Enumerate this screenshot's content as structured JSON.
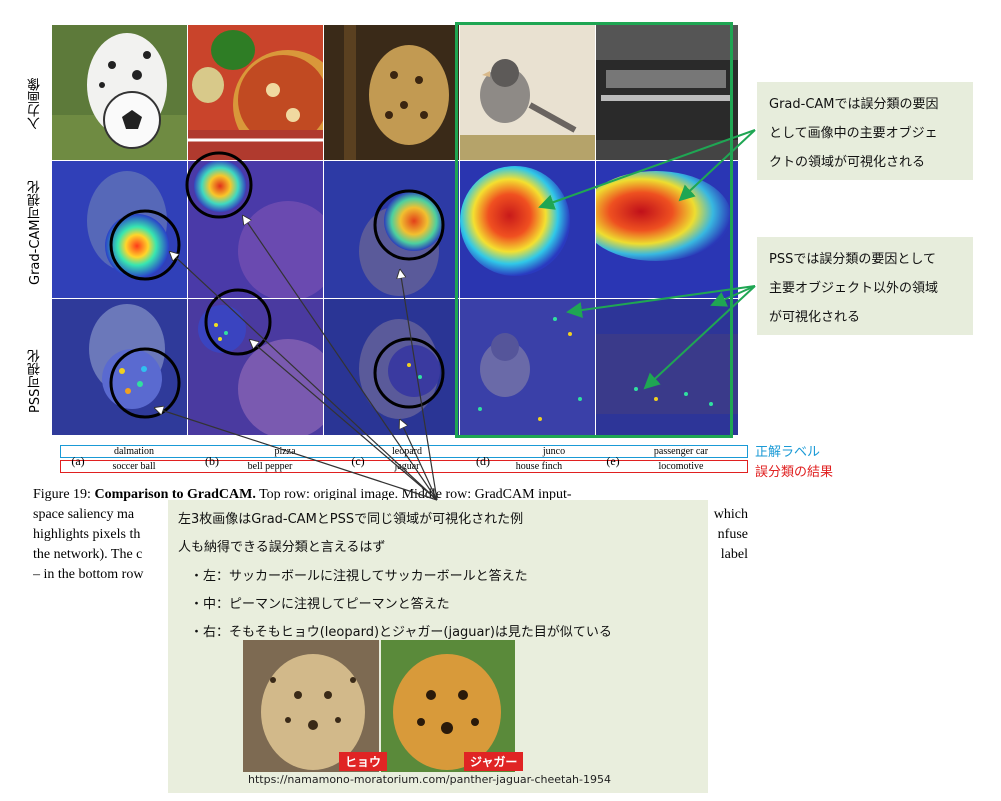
{
  "row_labels": [
    "入力画像",
    "Grad-CAM可視化",
    "PSS可視化"
  ],
  "columns": [
    {
      "letter": "(a)",
      "true_label": "dalmation",
      "misclassified": "soccer ball"
    },
    {
      "letter": "(b)",
      "true_label": "pizza",
      "misclassified": "bell pepper"
    },
    {
      "letter": "(c)",
      "true_label": "leopard",
      "misclassified": "jaguar"
    },
    {
      "letter": "(d)",
      "true_label": "junco",
      "misclassified": "house finch"
    },
    {
      "letter": "(e)",
      "true_label": "passenger car",
      "misclassified": "locomotive"
    }
  ],
  "legend": {
    "true_label": "正解ラベル",
    "misclassified": "誤分類の結果",
    "true_color": "#1a9ad6",
    "mis_color": "#e02020"
  },
  "caption": {
    "figure_label": "Figure 19: ",
    "title": "Comparison to GradCAM.",
    "line1_rest": " Top row: original image. Middle row: GradCAM input-",
    "line2_left": "space saliency ma",
    "line2_right": "which",
    "line3_left": "highlights pixels th",
    "line3_right": "nfuse",
    "line4_left": "the network). The c",
    "line4_right": "label",
    "line5_left": "– in the bottom row"
  },
  "notes": {
    "gradcam": [
      "Grad-CAMでは誤分類の要因",
      "として画像中の主要オブジェ",
      "クトの領域が可視化される"
    ],
    "pss": [
      "PSSでは誤分類の要因として",
      "主要オブジェクト以外の領域",
      "が可視化される"
    ]
  },
  "bigbox": {
    "line1": "左3枚画像はGrad-CAMとPSSで同じ領域が可視化された例",
    "line2": "人も納得できる誤分類と言えるはず",
    "line3": "・左：サッカーボールに注視してサッカーボールと答えた",
    "line4": "・中：ピーマンに注視してピーマンと答えた",
    "line5": "・右：そもそもヒョウ(leopard)とジャガー(jaguar)は見た目が似ている",
    "tag_left": "ヒョウ",
    "tag_right": "ジャガー",
    "url": "https://namamono-moratorium.com/panther-jaguar-cheetah-1954"
  },
  "colors": {
    "green": "#1fa653",
    "note_bg": "#e7eddc"
  }
}
